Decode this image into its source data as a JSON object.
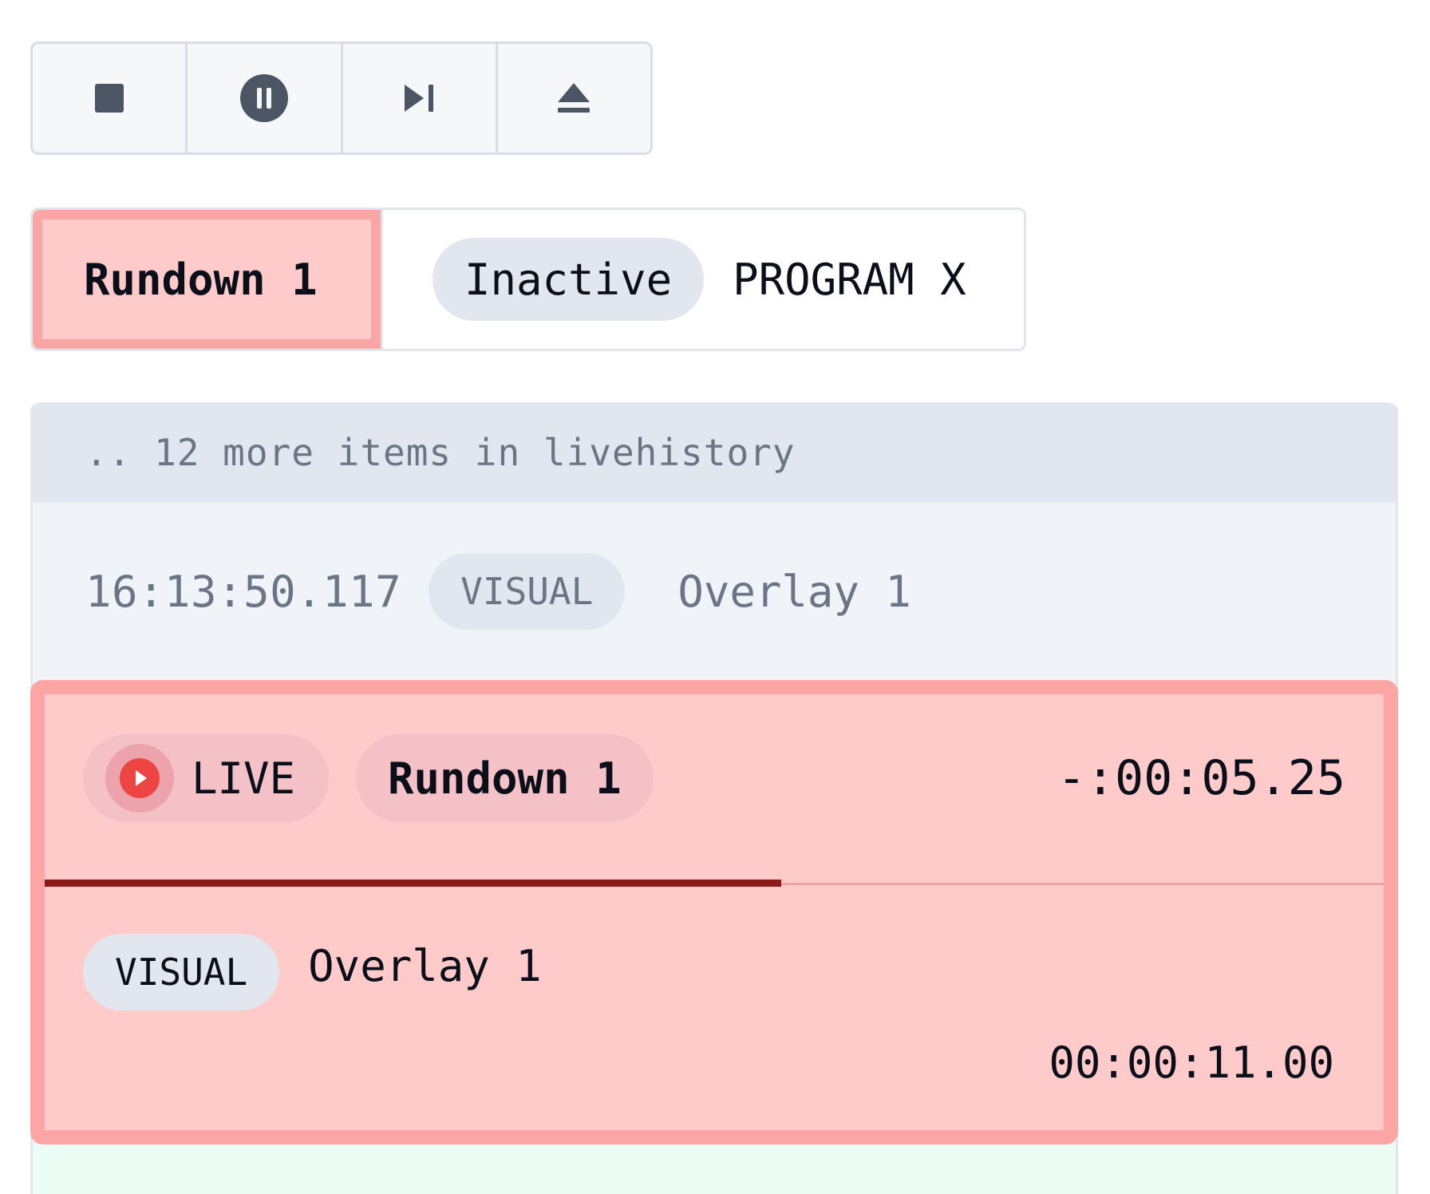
{
  "toolbar": {
    "buttons": [
      {
        "icon": "stop-icon",
        "color": "#4b5563"
      },
      {
        "icon": "pause-circle-icon",
        "color": "#4b5563"
      },
      {
        "icon": "skip-next-icon",
        "color": "#4b5563"
      },
      {
        "icon": "eject-icon",
        "color": "#4b5563"
      }
    ]
  },
  "tabs": {
    "active_tab": "Rundown 1",
    "status_pill": "Inactive",
    "program_label": "PROGRAM X"
  },
  "history": {
    "header": ".. 12 more items in livehistory",
    "rows": [
      {
        "time": "16:13:50.117",
        "tag": "VISUAL",
        "title": "Overlay 1"
      }
    ]
  },
  "live": {
    "live_label": "LIVE",
    "rundown_label": "Rundown 1",
    "countdown": "-:00:05.25",
    "progress_fraction": 0.55,
    "item": {
      "tag": "VISUAL",
      "title": "Overlay 1",
      "duration": "00:00:11.00"
    }
  },
  "colors": {
    "live_bg": "#fecaca",
    "live_border": "#fca5a5",
    "live_dot": "#ef4444",
    "progress": "#8b1a1a",
    "pill_bg": "#e2e7ef",
    "muted_text": "#6b7585",
    "next_bg": "#ecfdf5"
  }
}
